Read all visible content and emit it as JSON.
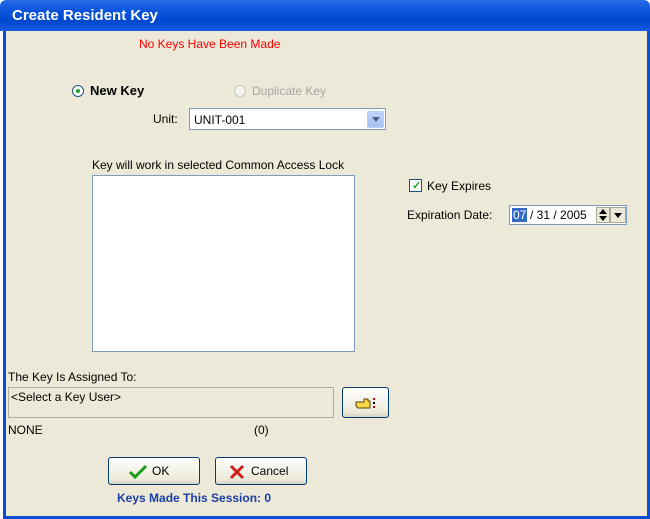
{
  "window": {
    "title": "Create Resident Key"
  },
  "status_message": "No Keys Have Been Made",
  "key_type": {
    "new_key_label": "New Key",
    "duplicate_key_label": "Duplicate Key",
    "selected": "New Key"
  },
  "unit": {
    "label": "Unit:",
    "value": "UNIT-001"
  },
  "lock_list": {
    "label": "Key will work in selected Common Access Lock",
    "items": []
  },
  "expires": {
    "label": "Key Expires",
    "checked": true
  },
  "expiration": {
    "label": "Expiration Date:",
    "month": "07",
    "rest": "/ 31 / 2005"
  },
  "assigned": {
    "label": "The Key Is Assigned To:",
    "placeholder": "<Select a Key User>",
    "name": "NONE",
    "count": "(0)"
  },
  "buttons": {
    "ok": "OK",
    "cancel": "Cancel"
  },
  "session": {
    "label": "Keys Made This Session: 0"
  },
  "colors": {
    "title_bar": "#0a54dc",
    "status_text": "#ff0000",
    "session_text": "#1a3fa6"
  }
}
